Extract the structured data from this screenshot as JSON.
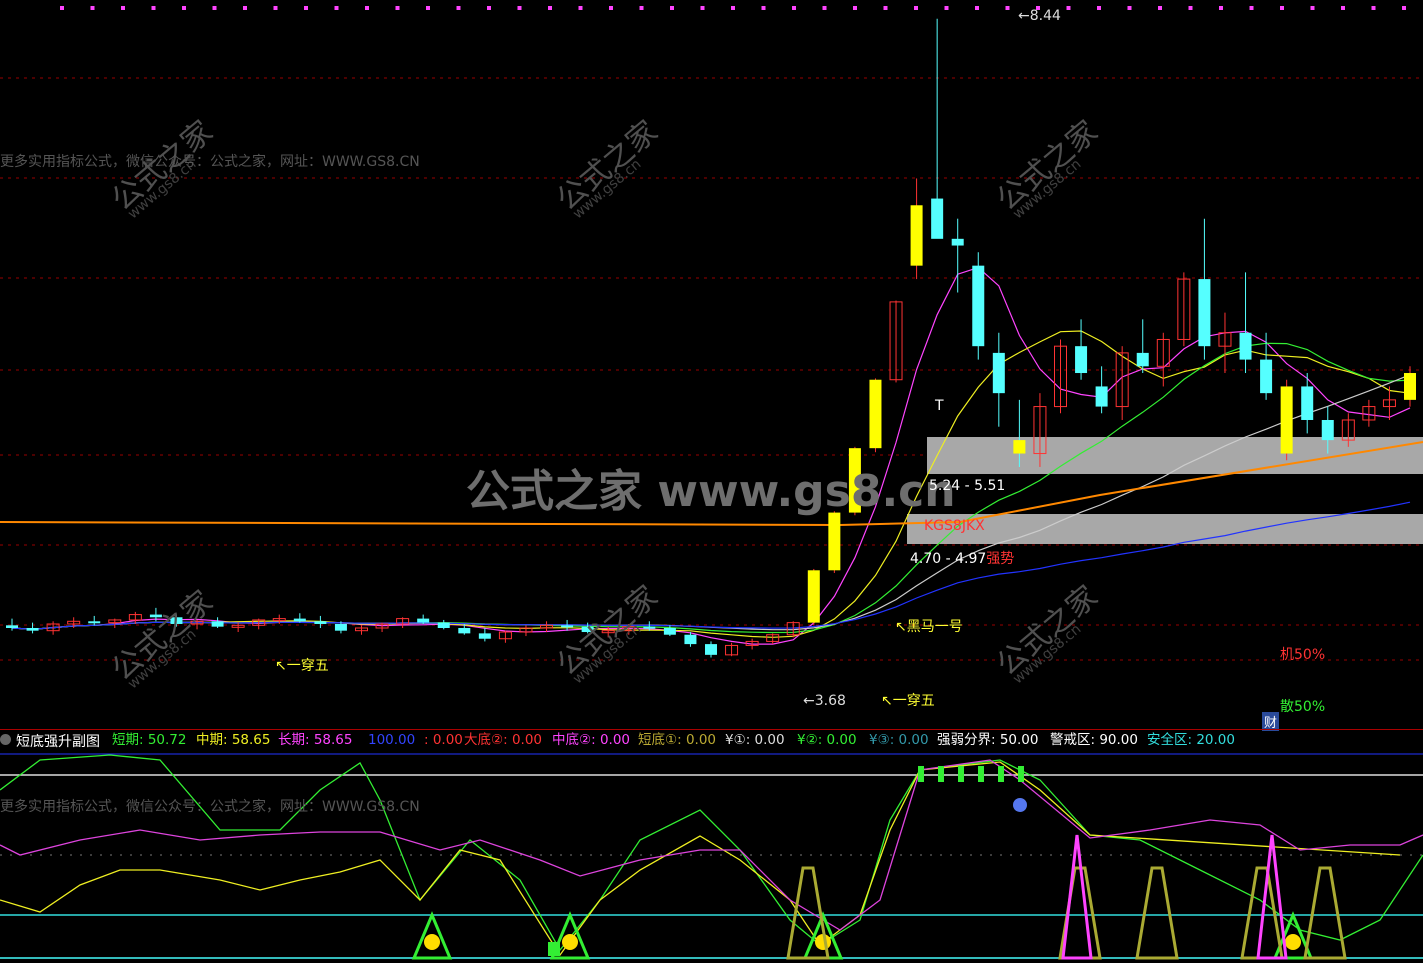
{
  "colors": {
    "up": "#ff3333",
    "down": "#55ffff",
    "signal": "#ffff00",
    "short": "#33ee33",
    "mid": "#eeee22",
    "long": "#ff44ff",
    "grid": "#aa0000",
    "band": "#a8a8a8"
  },
  "main": {
    "notice": "更多实用指标公式，微信公众号：公式之家，网址：WWW.GS8.CN",
    "watermark_big": "公式之家 www.gs8.cn",
    "watermark_small": "公式之家",
    "watermark_url": "www.gs8.cn",
    "high_label": "8.44",
    "low_label": "3.68",
    "yichuanwu_1": "↖一穿五",
    "yichuanwu_2": "↖一穿五",
    "heima_label": "↖黑马一号",
    "zone_label_1": "5.24 - 5.51",
    "zone_label_2": "KGS8JKX",
    "zone_label_3": "4.70 - 4.97",
    "zone_label_3b": "强势",
    "t_marker": "T",
    "ji_label": "机50%",
    "san_label": "散50%",
    "cai_label": "财"
  },
  "sub": {
    "title": "短底强升副图",
    "notice": "更多实用指标公式，微信公众号：公式之家，网址：WWW.GS8.CN",
    "legend": [
      {
        "text": "短期: 50.72",
        "color": "#33ee33"
      },
      {
        "text": "中期: 58.65",
        "color": "#eeee22"
      },
      {
        "text": "长期: 58.65",
        "color": "#ff44ff"
      },
      {
        "text": "100.00",
        "color": "#3344ff"
      },
      {
        "text": ": 0.00",
        "color": "#ff3333"
      },
      {
        "text": "大底②: 0.00",
        "color": "#ff3333"
      },
      {
        "text": "中底②: 0.00",
        "color": "#ff44ff"
      },
      {
        "text": "短底①: 0.00",
        "color": "#bbaa33"
      },
      {
        "text": "¥①: 0.00",
        "color": "#dddddd"
      },
      {
        "text": "¥②: 0.00",
        "color": "#33ee33"
      },
      {
        "text": "¥③: 0.00",
        "color": "#3399aa"
      },
      {
        "text": "强弱分界: 50.00",
        "color": "#ffffff"
      },
      {
        "text": "警戒区: 90.00",
        "color": "#ffffff"
      },
      {
        "text": "安全区: 20.00",
        "color": "#33dddd"
      }
    ]
  },
  "chart_data": {
    "type": "candlestick",
    "ohlc_estimated": [
      [
        3.92,
        3.97,
        3.88,
        3.9
      ],
      [
        3.9,
        3.94,
        3.86,
        3.88
      ],
      [
        3.88,
        3.95,
        3.85,
        3.93
      ],
      [
        3.93,
        3.98,
        3.9,
        3.95
      ],
      [
        3.95,
        3.99,
        3.92,
        3.94
      ],
      [
        3.94,
        3.97,
        3.9,
        3.96
      ],
      [
        3.96,
        4.02,
        3.93,
        4.0
      ],
      [
        4.0,
        4.05,
        3.95,
        3.98
      ],
      [
        3.98,
        4.0,
        3.91,
        3.93
      ],
      [
        3.93,
        3.96,
        3.89,
        3.95
      ],
      [
        3.95,
        3.98,
        3.9,
        3.91
      ],
      [
        3.91,
        3.94,
        3.87,
        3.92
      ],
      [
        3.92,
        3.97,
        3.89,
        3.96
      ],
      [
        3.96,
        4.0,
        3.93,
        3.97
      ],
      [
        3.97,
        4.01,
        3.94,
        3.95
      ],
      [
        3.95,
        3.99,
        3.9,
        3.93
      ],
      [
        3.93,
        3.95,
        3.86,
        3.88
      ],
      [
        3.88,
        3.92,
        3.85,
        3.9
      ],
      [
        3.9,
        3.94,
        3.87,
        3.93
      ],
      [
        3.93,
        3.98,
        3.9,
        3.97
      ],
      [
        3.97,
        4.0,
        3.93,
        3.94
      ],
      [
        3.94,
        3.96,
        3.89,
        3.9
      ],
      [
        3.9,
        3.93,
        3.85,
        3.86
      ],
      [
        3.86,
        3.9,
        3.8,
        3.82
      ],
      [
        3.82,
        3.88,
        3.79,
        3.87
      ],
      [
        3.87,
        3.92,
        3.84,
        3.9
      ],
      [
        3.9,
        3.95,
        3.87,
        3.92
      ],
      [
        3.92,
        3.96,
        3.88,
        3.91
      ],
      [
        3.91,
        3.94,
        3.86,
        3.87
      ],
      [
        3.87,
        3.91,
        3.83,
        3.88
      ],
      [
        3.88,
        3.93,
        3.85,
        3.91
      ],
      [
        3.91,
        3.95,
        3.88,
        3.9
      ],
      [
        3.9,
        3.92,
        3.84,
        3.85
      ],
      [
        3.85,
        3.87,
        3.76,
        3.78
      ],
      [
        3.78,
        3.8,
        3.68,
        3.7
      ],
      [
        3.7,
        3.79,
        3.69,
        3.77
      ],
      [
        3.77,
        3.82,
        3.74,
        3.8
      ],
      [
        3.8,
        3.86,
        3.78,
        3.85
      ],
      [
        3.85,
        3.95,
        3.83,
        3.94
      ],
      [
        3.94,
        4.34,
        3.92,
        4.33
      ],
      [
        4.33,
        4.77,
        4.31,
        4.76
      ],
      [
        4.76,
        5.25,
        4.74,
        5.24
      ],
      [
        5.24,
        5.76,
        5.21,
        5.75
      ],
      [
        5.75,
        6.34,
        5.73,
        6.33
      ],
      [
        6.6,
        7.25,
        6.5,
        7.05
      ],
      [
        7.1,
        8.44,
        6.9,
        6.8
      ],
      [
        6.8,
        6.95,
        6.4,
        6.75
      ],
      [
        6.6,
        6.7,
        5.9,
        6.0
      ],
      [
        5.95,
        6.1,
        5.4,
        5.65
      ],
      [
        5.3,
        5.6,
        5.1,
        5.2
      ],
      [
        5.2,
        5.65,
        5.1,
        5.55
      ],
      [
        5.55,
        6.05,
        5.5,
        6.0
      ],
      [
        6.0,
        6.2,
        5.75,
        5.8
      ],
      [
        5.7,
        5.85,
        5.5,
        5.55
      ],
      [
        5.55,
        6.0,
        5.45,
        5.95
      ],
      [
        5.95,
        6.2,
        5.8,
        5.85
      ],
      [
        5.85,
        6.1,
        5.7,
        6.05
      ],
      [
        6.05,
        6.55,
        6.0,
        6.5
      ],
      [
        6.5,
        6.95,
        5.9,
        6.0
      ],
      [
        6.0,
        6.25,
        5.8,
        6.1
      ],
      [
        6.1,
        6.55,
        5.8,
        5.9
      ],
      [
        5.9,
        6.1,
        5.6,
        5.65
      ],
      [
        5.2,
        5.75,
        5.15,
        5.7
      ],
      [
        5.7,
        5.8,
        5.35,
        5.45
      ],
      [
        5.45,
        5.55,
        5.2,
        5.3
      ],
      [
        5.3,
        5.5,
        5.25,
        5.45
      ],
      [
        5.45,
        5.6,
        5.4,
        5.55
      ],
      [
        5.55,
        5.7,
        5.45,
        5.6
      ],
      [
        5.6,
        5.85,
        5.55,
        5.8
      ]
    ],
    "high_marker": 8.44,
    "low_marker": 3.68,
    "zones": [
      "5.24 - 5.51",
      "4.70 - 4.97"
    ],
    "sub_levels": {
      "strong_weak": 50.0,
      "alert": 90.0,
      "safe": 20.0
    },
    "sub_values": {
      "short": 50.72,
      "mid": 58.65,
      "long": 58.65
    }
  }
}
